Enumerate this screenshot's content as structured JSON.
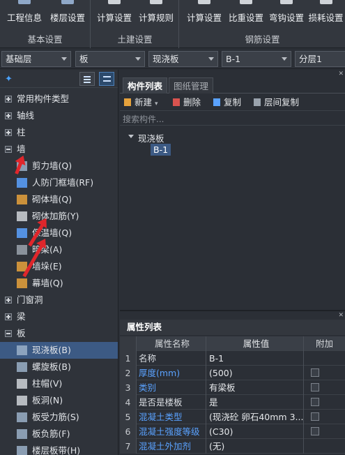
{
  "ribbon": {
    "groups": [
      {
        "title": "基本设置",
        "buttons": [
          "工程信息",
          "楼层设置"
        ]
      },
      {
        "title": "土建设置",
        "buttons": [
          "计算设置",
          "计算规则"
        ]
      },
      {
        "title": "钢筋设置",
        "buttons": [
          "计算设置",
          "比重设置",
          "弯钩设置",
          "损耗设置"
        ]
      }
    ]
  },
  "combos": {
    "floor": "基础层",
    "category": "板",
    "type": "现浇板",
    "component": "B-1",
    "layer": "分层1"
  },
  "tree": [
    {
      "label": "常用构件类型",
      "kind": "group",
      "expanded": false
    },
    {
      "label": "轴线",
      "kind": "group",
      "expanded": false
    },
    {
      "label": "柱",
      "kind": "group",
      "expanded": false
    },
    {
      "label": "墙",
      "kind": "group",
      "expanded": true
    },
    {
      "label": "剪力墙(Q)",
      "kind": "item",
      "icon": "shear-wall-icon"
    },
    {
      "label": "人防门框墙(RF)",
      "kind": "item",
      "icon": "civil-defense-door-wall-icon"
    },
    {
      "label": "砌体墙(Q)",
      "kind": "item",
      "icon": "masonry-wall-icon"
    },
    {
      "label": "砌体加筋(Y)",
      "kind": "item",
      "icon": "masonry-reinforcement-icon"
    },
    {
      "label": "保温墙(Q)",
      "kind": "item",
      "icon": "insulation-wall-icon"
    },
    {
      "label": "暗梁(A)",
      "kind": "item",
      "icon": "hidden-beam-icon"
    },
    {
      "label": "墙垛(E)",
      "kind": "item",
      "icon": "wall-pier-icon"
    },
    {
      "label": "幕墙(Q)",
      "kind": "item",
      "icon": "curtain-wall-icon"
    },
    {
      "label": "门窗洞",
      "kind": "group",
      "expanded": false
    },
    {
      "label": "梁",
      "kind": "group",
      "expanded": false
    },
    {
      "label": "板",
      "kind": "group",
      "expanded": true
    },
    {
      "label": "现浇板(B)",
      "kind": "item",
      "icon": "cast-slab-icon",
      "selected": true
    },
    {
      "label": "螺旋板(B)",
      "kind": "item",
      "icon": "spiral-slab-icon"
    },
    {
      "label": "柱帽(V)",
      "kind": "item",
      "icon": "column-cap-icon"
    },
    {
      "label": "板洞(N)",
      "kind": "item",
      "icon": "slab-hole-icon"
    },
    {
      "label": "板受力筋(S)",
      "kind": "item",
      "icon": "slab-main-rebar-icon"
    },
    {
      "label": "板负筋(F)",
      "kind": "item",
      "icon": "slab-negative-rebar-icon"
    },
    {
      "label": "楼层板带(H)",
      "kind": "item",
      "icon": "floor-slab-strip-icon"
    }
  ],
  "component_panel": {
    "tabs": [
      "构件列表",
      "图纸管理"
    ],
    "active_tab": 0,
    "toolbar": {
      "new": "新建",
      "delete": "删除",
      "copy": "复制",
      "floor_copy": "层间复制"
    },
    "search_placeholder": "搜索构件...",
    "tree": {
      "group": "现浇板",
      "item": "B-1"
    }
  },
  "property_panel": {
    "title": "属性列表",
    "columns": [
      "属性名称",
      "属性值",
      "附加"
    ],
    "rows": [
      {
        "num": "1",
        "name": "名称",
        "value": "B-1",
        "blue": false,
        "checkbox": false
      },
      {
        "num": "2",
        "name": "厚度(mm)",
        "value": "(500)",
        "blue": true,
        "checkbox": true
      },
      {
        "num": "3",
        "name": "类别",
        "value": "有梁板",
        "blue": true,
        "checkbox": true
      },
      {
        "num": "4",
        "name": "是否是楼板",
        "value": "是",
        "blue": false,
        "checkbox": true
      },
      {
        "num": "5",
        "name": "混凝土类型",
        "value": "(现浇砼 卵石40mm 3...",
        "blue": true,
        "checkbox": true
      },
      {
        "num": "6",
        "name": "混凝土强度等级",
        "value": "(C30)",
        "blue": true,
        "checkbox": true
      },
      {
        "num": "7",
        "name": "混凝土外加剂",
        "value": "(无)",
        "blue": true,
        "checkbox": false
      }
    ]
  },
  "colors": {
    "accent": "#3c5a84",
    "blue_text": "#5aa2ff",
    "annotation_red": "#e0262b"
  }
}
